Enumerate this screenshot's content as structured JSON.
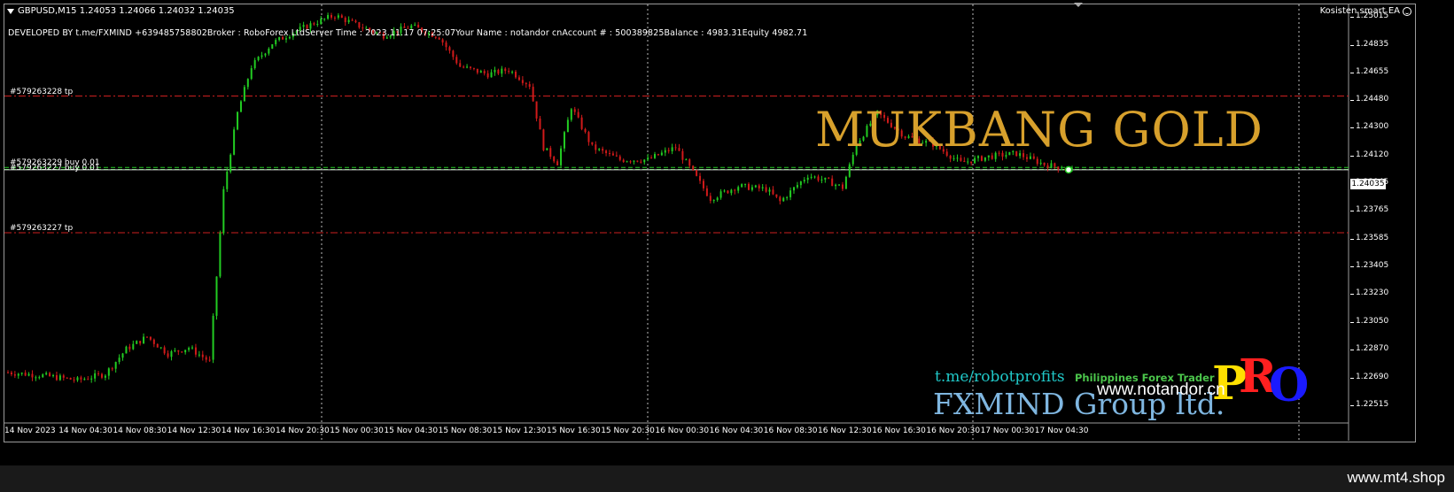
{
  "header": {
    "symbol_text": "GBPUSD,M15  1.24053 1.24066 1.24032 1.24035",
    "info_text": "DEVELOPED BY t.me/FXMIND  +639485758802Broker  : RoboForex LtdServer Time : 2023.11.17 07:25:07Your Name    : notandor cnAccount #  : 500389825Balance : 4983.31Equity     4982.71",
    "ea_name": "Kosisten smart EA",
    "ea_icon": "smiley-icon"
  },
  "order_lines": [
    {
      "label": "#579263228 tp",
      "price": 1.2451,
      "color": "#cc1f1f"
    },
    {
      "label": "#579263229 buy 0.01",
      "price": 1.2405,
      "color": "#22cc22"
    },
    {
      "label": "#579263227 buy 0.01",
      "price": 1.24037,
      "color": "#22cc22"
    },
    {
      "label": "#579263227 tp",
      "price": 1.2363,
      "color": "#cc1f1f"
    }
  ],
  "price_axis": {
    "ticks": [
      "1.25015",
      "1.24835",
      "1.24655",
      "1.24480",
      "1.24300",
      "1.24120",
      "1.23945",
      "1.23765",
      "1.23585",
      "1.23405",
      "1.23230",
      "1.23050",
      "1.22870",
      "1.22690",
      "1.22515"
    ],
    "current_price": "1.24035"
  },
  "time_axis": {
    "labels": [
      "14 Nov 2023",
      "14 Nov 04:30",
      "14 Nov 08:30",
      "14 Nov 12:30",
      "14 Nov 16:30",
      "14 Nov 20:30",
      "15 Nov 00:30",
      "15 Nov 04:30",
      "15 Nov 08:30",
      "15 Nov 12:30",
      "15 Nov 16:30",
      "15 Nov 20:30",
      "16 Nov 00:30",
      "16 Nov 04:30",
      "16 Nov 08:30",
      "16 Nov 12:30",
      "16 Nov 16:30",
      "16 Nov 20:30",
      "17 Nov 00:30",
      "17 Nov 04:30"
    ]
  },
  "overlay": {
    "title": "MUKBANG GOLD",
    "telegram": "t.me/robotprofits",
    "trader_text": "Philippines Forex Trader",
    "group_name": "FXMIND Group ltd.",
    "watermark": "www.notandor.cn",
    "pro_letters": [
      "P",
      "R",
      "O"
    ]
  },
  "footer": {
    "text": "www.mt4.shop"
  },
  "colors": {
    "bull": "#22cc22",
    "bear": "#d11a1a",
    "grid": "#bbbbbb",
    "title": "#d7a02c"
  },
  "chart_data": {
    "type": "candlestick",
    "symbol": "GBPUSD",
    "timeframe": "M15",
    "last_bar": {
      "open": 1.24053,
      "high": 1.24066,
      "low": 1.24032,
      "close": 1.24035
    },
    "ylim": [
      1.2245,
      1.251
    ],
    "close_path": [
      [
        0,
        1.2273
      ],
      [
        10,
        1.2271
      ],
      [
        20,
        1.2268
      ],
      [
        28,
        1.2272
      ],
      [
        34,
        1.2288
      ],
      [
        40,
        1.2296
      ],
      [
        46,
        1.2285
      ],
      [
        52,
        1.2289
      ],
      [
        58,
        1.228
      ],
      [
        62,
        1.239
      ],
      [
        66,
        1.244
      ],
      [
        70,
        1.247
      ],
      [
        76,
        1.2485
      ],
      [
        82,
        1.2492
      ],
      [
        88,
        1.2498
      ],
      [
        94,
        1.2503
      ],
      [
        100,
        1.2497
      ],
      [
        108,
        1.249
      ],
      [
        116,
        1.2496
      ],
      [
        124,
        1.2489
      ],
      [
        130,
        1.247
      ],
      [
        138,
        1.2465
      ],
      [
        144,
        1.2468
      ],
      [
        150,
        1.2458
      ],
      [
        154,
        1.2418
      ],
      [
        158,
        1.2408
      ],
      [
        162,
        1.2444
      ],
      [
        168,
        1.2418
      ],
      [
        176,
        1.241
      ],
      [
        184,
        1.241
      ],
      [
        192,
        1.2418
      ],
      [
        196,
        1.2405
      ],
      [
        202,
        1.2385
      ],
      [
        210,
        1.2393
      ],
      [
        218,
        1.2391
      ],
      [
        222,
        1.2383
      ],
      [
        230,
        1.24
      ],
      [
        236,
        1.2396
      ],
      [
        240,
        1.2392
      ],
      [
        244,
        1.242
      ],
      [
        250,
        1.244
      ],
      [
        258,
        1.2425
      ],
      [
        266,
        1.242
      ],
      [
        274,
        1.2408
      ],
      [
        282,
        1.2412
      ],
      [
        290,
        1.2414
      ],
      [
        298,
        1.2407
      ],
      [
        306,
        1.24035
      ]
    ],
    "bars_count": 306
  }
}
